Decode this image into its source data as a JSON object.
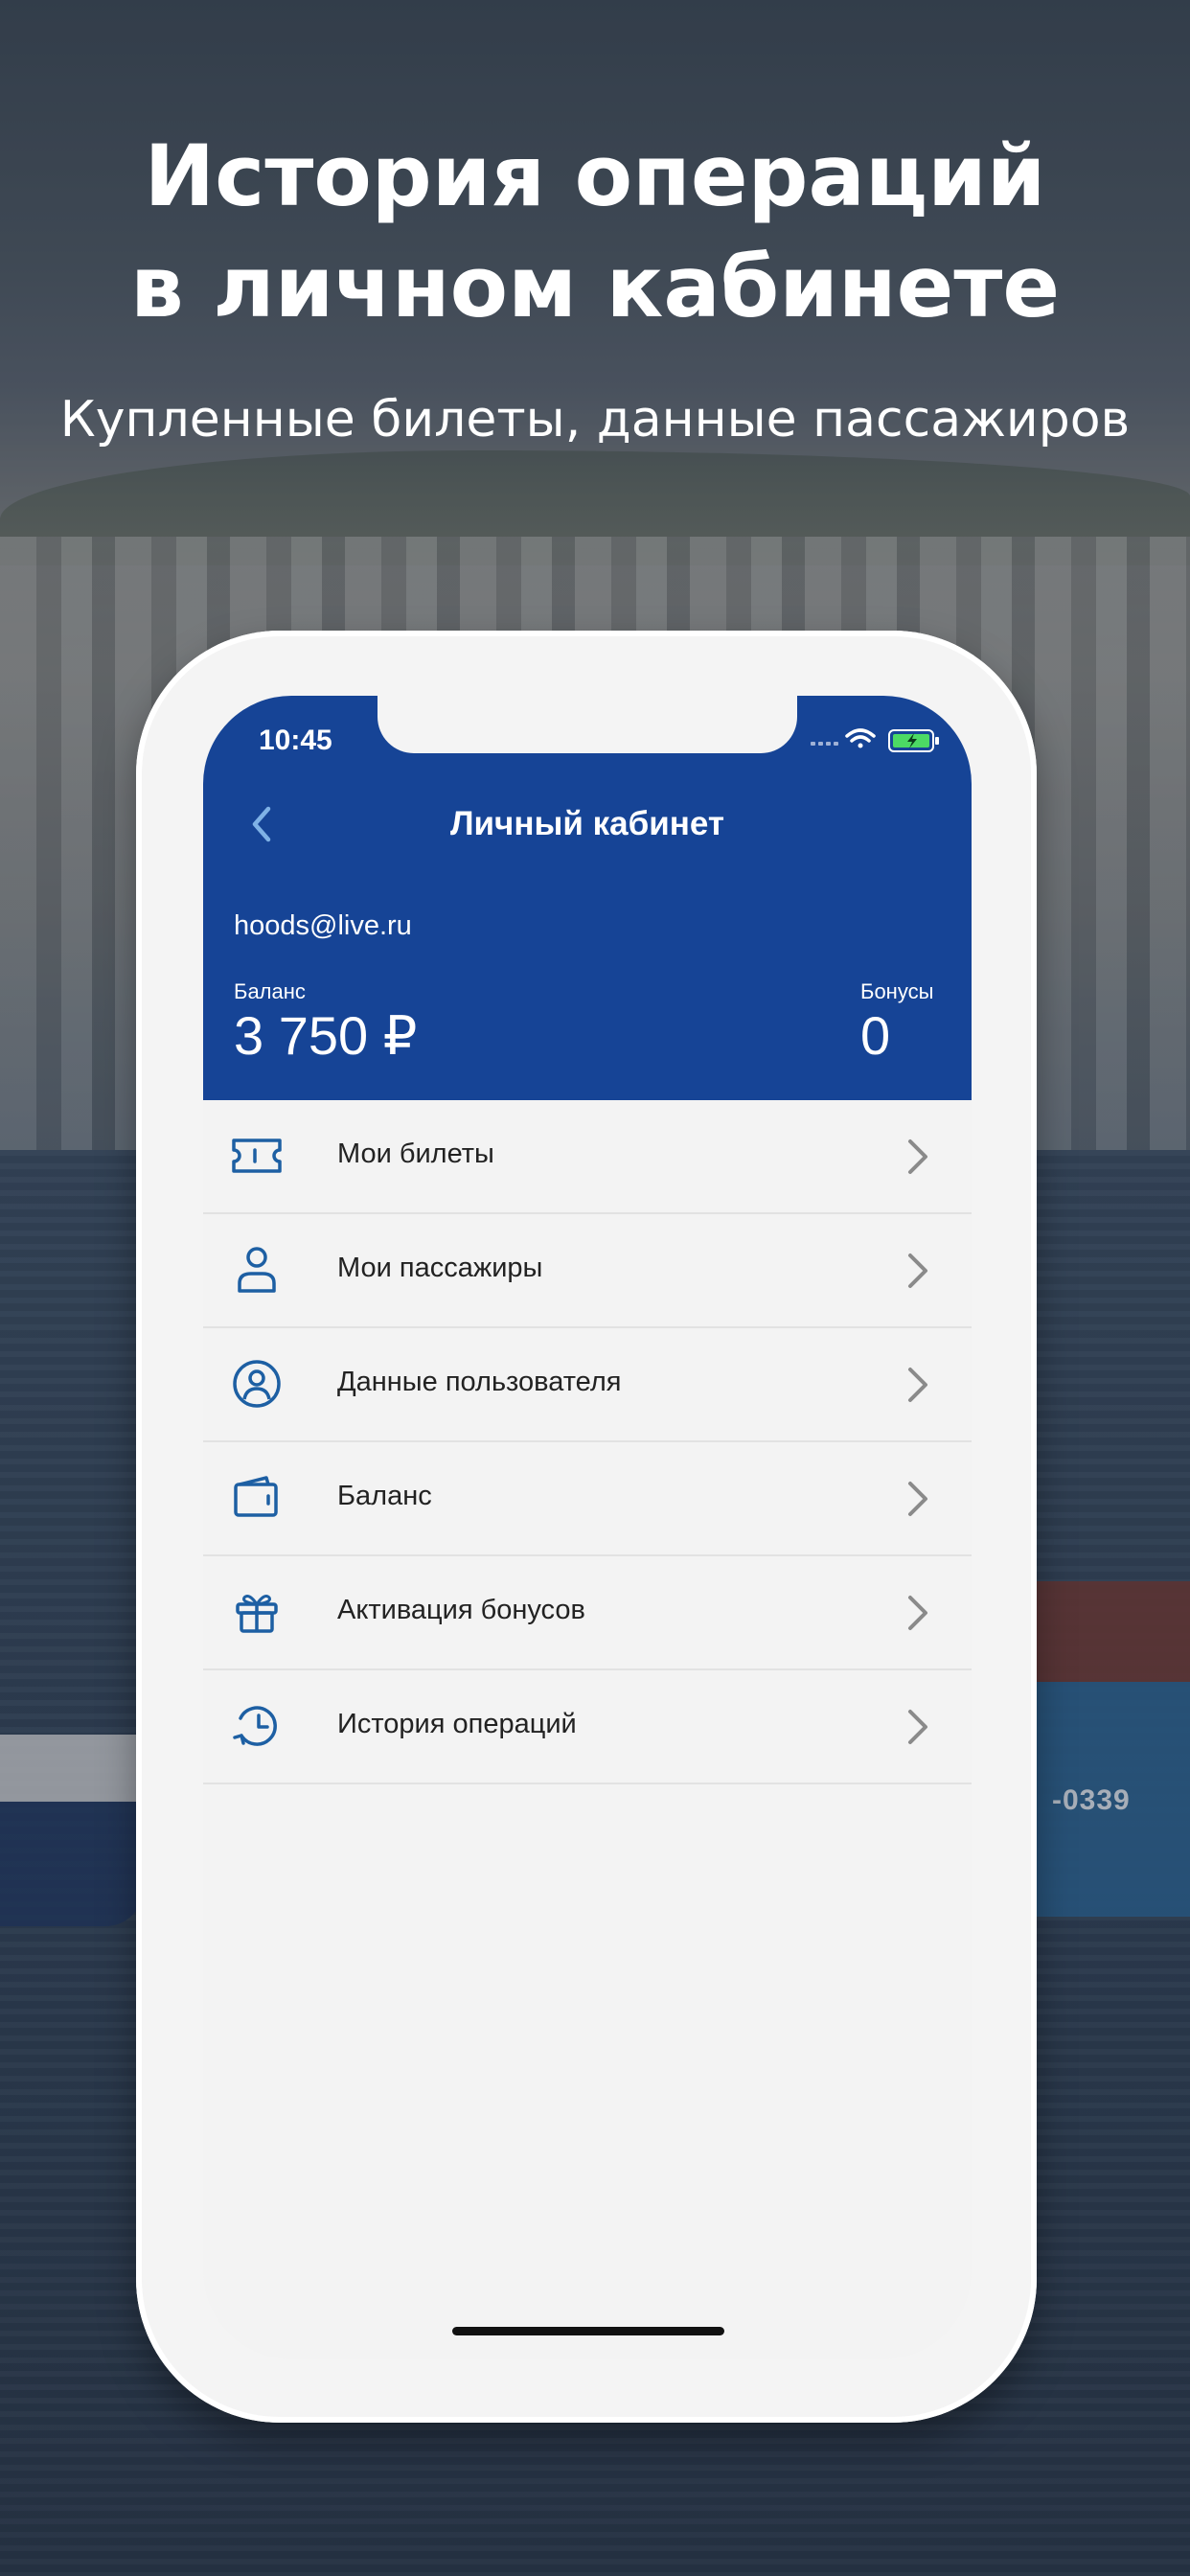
{
  "promo": {
    "headline_line1": "История операций",
    "headline_line2": "в личном кабинете",
    "subtitle": "Купленные билеты, данные пассажиров"
  },
  "background": {
    "ship_number": "-0339"
  },
  "status_bar": {
    "time": "10:45"
  },
  "header": {
    "title": "Личный кабинет",
    "email": "hoods@live.ru",
    "balance_label": "Баланс",
    "balance_value": "3 750 ₽",
    "bonus_label": "Бонусы",
    "bonus_value": "0"
  },
  "menu": {
    "items": [
      {
        "label": "Мои билеты",
        "icon": "ticket-icon"
      },
      {
        "label": "Мои пассажиры",
        "icon": "person-icon"
      },
      {
        "label": "Данные пользователя",
        "icon": "user-circle-icon"
      },
      {
        "label": "Баланс",
        "icon": "wallet-icon"
      },
      {
        "label": "Активация бонусов",
        "icon": "gift-icon"
      },
      {
        "label": "История операций",
        "icon": "history-icon"
      }
    ]
  },
  "colors": {
    "header_blue": "#164496",
    "icon_blue": "#1d5fa3",
    "chevron_gray": "#8a8a8a",
    "screen_bg": "#f3f3f3"
  }
}
